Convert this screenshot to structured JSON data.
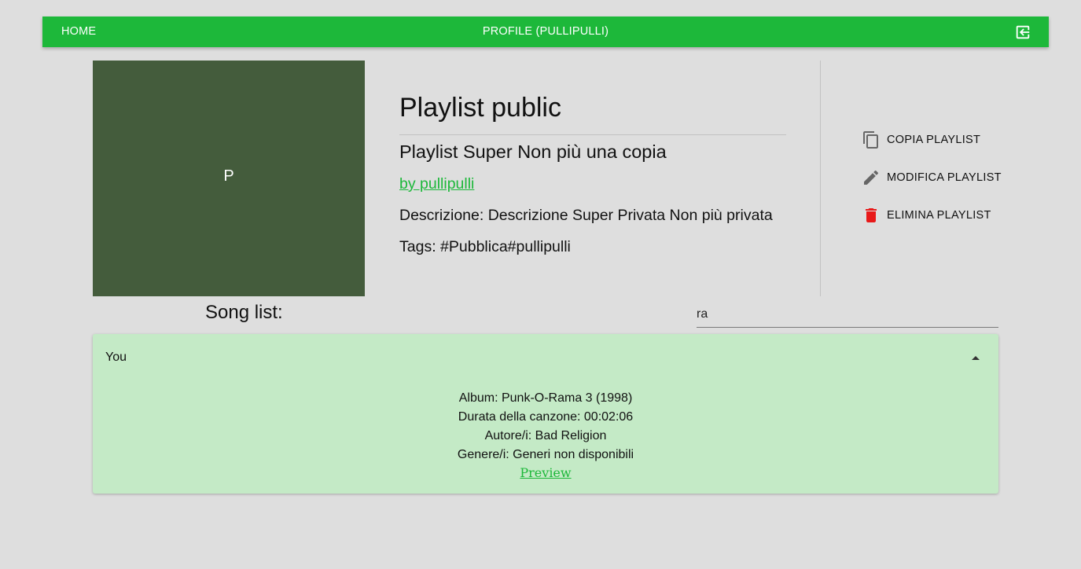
{
  "nav": {
    "home_label": "HOME",
    "profile_label": "PROFILE (PULLIPULLI)",
    "logout_icon": "logout-icon"
  },
  "playlist": {
    "cover_letter": "P",
    "cover_color": "#445c3c",
    "type_title": "Playlist public",
    "name": "Playlist Super Non più una copia",
    "owner": "by pullipulli",
    "description": "Descrizione: Descrizione Super Privata Non più privata",
    "tags": "Tags: #Pubblica#pullipulli"
  },
  "actions": {
    "copy_label": "COPIA PLAYLIST",
    "copy_icon": "copy-icon",
    "edit_label": "MODIFICA PLAYLIST",
    "edit_icon": "pencil-icon",
    "delete_label": "ELIMINA PLAYLIST",
    "delete_icon": "trash-icon",
    "delete_color": "#e81919"
  },
  "songs": {
    "title": "Song list:",
    "search_value": "ra",
    "items": [
      {
        "title": "You",
        "expanded": true,
        "album": "Album: Punk-O-Rama 3 (1998)",
        "duration": "Durata della canzone: 00:02:06",
        "authors": "Autore/i: Bad Religion",
        "genres": "Genere/i: Generi non disponibili",
        "preview_label": "Preview"
      }
    ]
  },
  "colors": {
    "accent": "#1db83a",
    "background": "#dedede",
    "song_panel": "#c4eac6"
  }
}
